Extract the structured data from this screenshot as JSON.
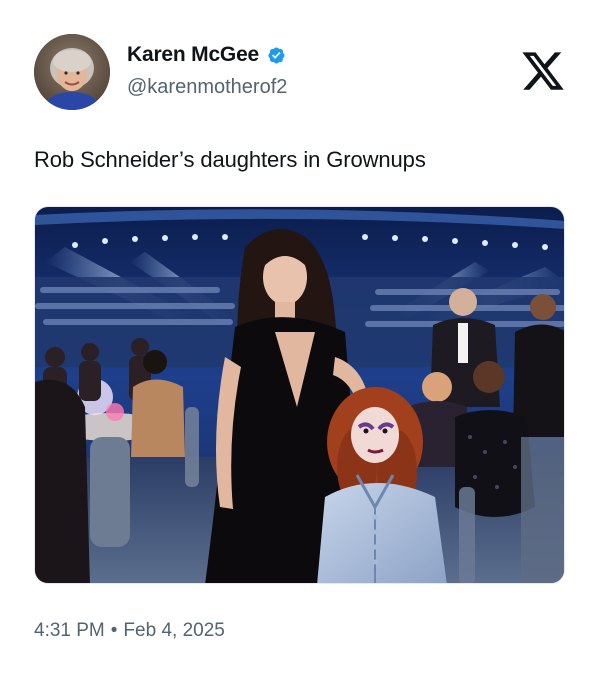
{
  "author": {
    "display_name": "Karen McGee",
    "handle": "@karenmotherof2",
    "verified": true,
    "avatar_icon": "profile-photo"
  },
  "brand": {
    "logo_icon": "x-logo-icon"
  },
  "tweet": {
    "text": "Rob Schneider’s daughters in Grownups",
    "media": {
      "type": "photo",
      "icon": "event-photo"
    },
    "time": "4:31 PM",
    "separator": "•",
    "date": "Feb 4, 2025"
  },
  "colors": {
    "text_primary": "#0f1419",
    "text_secondary": "#536471",
    "verified_badge": "#1d9bf0"
  }
}
